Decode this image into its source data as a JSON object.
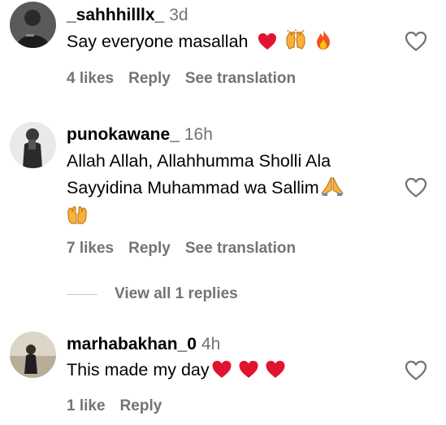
{
  "comments": [
    {
      "username": "_sahhhilllx_",
      "time": "3d",
      "text": "Say everyone masallah",
      "emojis": [
        "red-heart",
        "raising-hands",
        "fire"
      ],
      "likes": "4 likes",
      "reply": "Reply",
      "translate": "See translation"
    },
    {
      "username": "punokawane_",
      "time": "16h",
      "line1": "Allah Allah, Allahhumma Sholli Ala",
      "line2": "Sayyidina Muhammad wa Sallim",
      "emojis": [
        "folded-hands",
        "open-hands"
      ],
      "likes": "7 likes",
      "reply": "Reply",
      "translate": "See translation",
      "view_replies": "View all 1 replies"
    },
    {
      "username": "marhabakhan_0",
      "time": "4h",
      "text": "This made my day",
      "emojis": [
        "red-heart",
        "red-heart",
        "red-heart"
      ],
      "likes": "1 like",
      "reply": "Reply"
    }
  ],
  "colors": {
    "secondary_text": "#737373",
    "heart_red": "#e0142f",
    "divider": "#c7c7c7"
  }
}
